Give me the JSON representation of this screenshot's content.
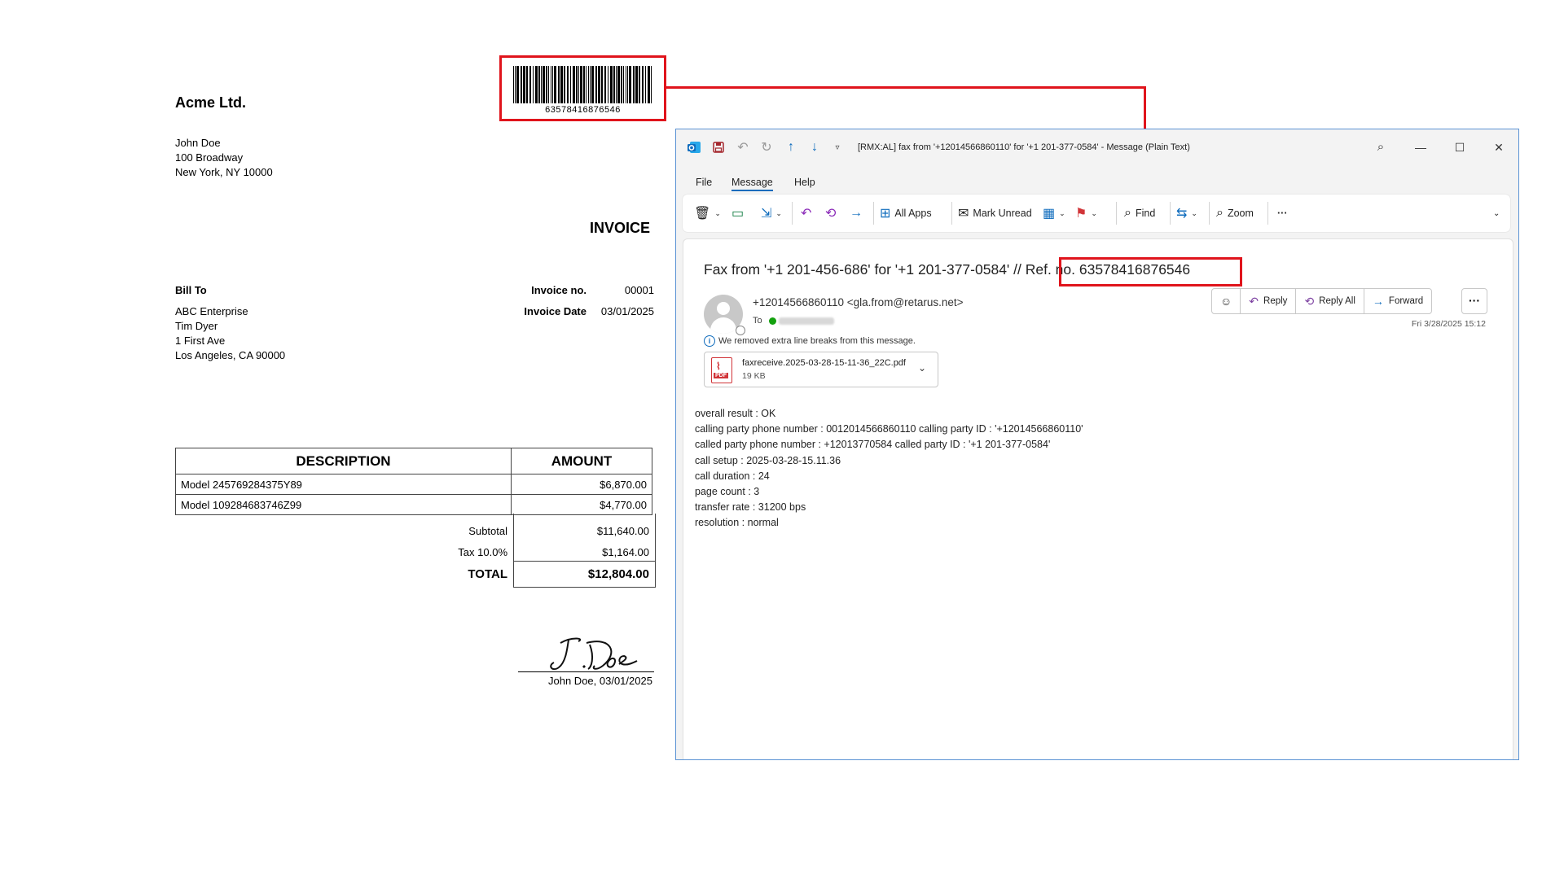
{
  "invoice": {
    "company": "Acme Ltd.",
    "address": [
      "John Doe",
      "100 Broadway",
      "New York, NY 10000"
    ],
    "barcode_number": "63578416876546",
    "title": "INVOICE",
    "bill_to_label": "Bill To",
    "bill_to": [
      "ABC Enterprise",
      "Tim Dyer",
      "1 First Ave",
      "Los Angeles, CA 90000"
    ],
    "invoice_no_label": "Invoice no.",
    "invoice_no": "00001",
    "invoice_date_label": "Invoice Date",
    "invoice_date": "03/01/2025",
    "table_headers": [
      "DESCRIPTION",
      "AMOUNT"
    ],
    "rows": [
      {
        "description": "Model 245769284375Y89",
        "amount": "$6,870.00"
      },
      {
        "description": "Model 109284683746Z99",
        "amount": "$4,770.00"
      }
    ],
    "subtotal_label": "Subtotal",
    "subtotal": "$11,640.00",
    "tax_label": "Tax 10.0%",
    "tax": "$1,164.00",
    "total_label": "TOTAL",
    "total": "$12,804.00",
    "signature_text": "J. Doe",
    "signature_caption": "John Doe, 03/01/2025"
  },
  "outlook": {
    "window_title": "[RMX:AL] fax from '+12014566860110' for '+1 201-377-0584'  -  Message (Plain Text)",
    "menu": [
      "File",
      "Message",
      "Help"
    ],
    "active_menu": "Message",
    "ribbon": {
      "all_apps": "All Apps",
      "mark_unread": "Mark Unread",
      "find": "Find",
      "zoom": "Zoom"
    },
    "subject": "Fax from '+1 201-456-686'  for '+1 201-377-0584' // Ref. no. 63578416876546",
    "from": "+12014566860110 <gla.from@retarus.net>",
    "to_label": "To",
    "actions": {
      "reply": "Reply",
      "reply_all": "Reply All",
      "forward": "Forward"
    },
    "date": "Fri 3/28/2025 15:12",
    "notice": "We removed extra line breaks from this message.",
    "attachment": {
      "name": "faxreceive.2025-03-28-15-11-36_22C.pdf",
      "size": "19 KB"
    },
    "body_lines": [
      "overall result : OK",
      "calling party phone number : 0012014566860110 calling party ID : '+12014566860110'",
      "called party phone number : +12013770584 called party ID : '+1 201-377-0584'",
      "call setup : 2025-03-28-15.11.36",
      "call duration : 24",
      "page count : 3",
      "transfer rate : 31200 bps",
      "resolution : normal"
    ]
  },
  "colors": {
    "highlight": "#e0141c",
    "accent": "#0f6cbd",
    "reply_icon": "#7b3fa0"
  },
  "icons": [
    "outlook-icon",
    "save-icon",
    "undo-icon",
    "redo-icon",
    "up-arrow-icon",
    "down-arrow-icon",
    "customize-icon",
    "search-icon",
    "minimize-icon",
    "maximize-icon",
    "close-icon",
    "delete-icon",
    "archive-icon",
    "move-icon",
    "undo-icon",
    "undo-all-icon",
    "forward-arrow-icon",
    "apps-icon",
    "envelope-icon",
    "categorize-icon",
    "flag-icon",
    "find-icon",
    "translate-icon",
    "zoom-icon",
    "more-icon",
    "emoji-icon",
    "reply-icon",
    "reply-all-icon",
    "forward-icon",
    "info-icon",
    "pdf-icon",
    "chevron-down-icon"
  ]
}
